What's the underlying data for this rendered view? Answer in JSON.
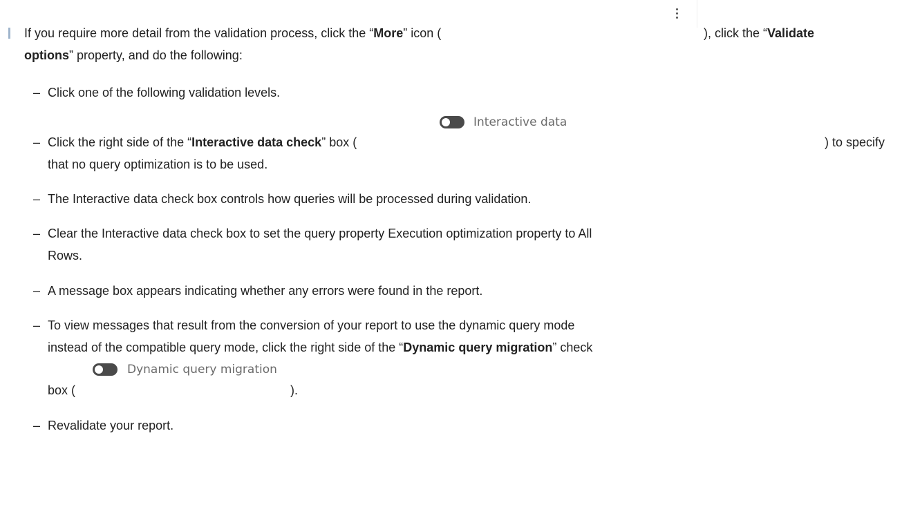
{
  "intro": {
    "p1": "If you require more detail from the validation process, click the “",
    "more_bold": "More",
    "p2": "” icon (",
    "p3": "), click the “",
    "validate_bold": "Validate",
    "options_bold": "options",
    "p4": "” property, and do the following:"
  },
  "steps": {
    "s1": "Click one of the following validation levels.",
    "s2a": "Click the right side of the “",
    "s2b": "Interactive data check",
    "s2c": "” box (",
    "s2d": ") to specify",
    "s2e": "that no query optimization is to be used.",
    "toggle1_label": "Interactive data",
    "s3": "The Interactive data check box controls how queries will be processed during validation.",
    "s4a": "Clear the Interactive data check box to set the query property Execution optimization property to All",
    "s4b": "Rows.",
    "s5": "A message box appears indicating whether any errors were found in the report.",
    "s6a": "To view messages that result from the conversion of your report to use the dynamic query mode",
    "s6b": "instead of the compatible query mode, click the right side of the “",
    "s6c": "Dynamic query migration",
    "s6d": "” check",
    "toggle2_label": "Dynamic query migration",
    "s6e": "box (",
    "s6f": ").",
    "s7": "Revalidate your report."
  },
  "dash": "–"
}
